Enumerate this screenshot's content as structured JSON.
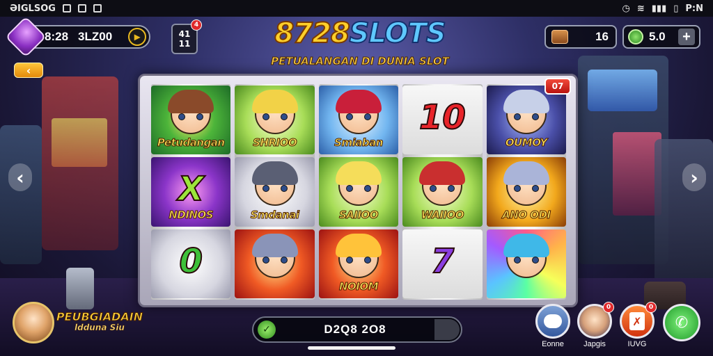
{
  "status_bar": {
    "left_text": "ƏIGLSOG",
    "right_text": "P:N"
  },
  "hud": {
    "time": "8:28",
    "balance": "3LZ00",
    "message_top": "41",
    "message_bottom": "11",
    "message_badge": "4",
    "tickets": "16",
    "score": "5.0"
  },
  "title": {
    "part1": "8728",
    "part2": "SLOTS",
    "subtitle": "PETUALANGAN DI DUNIA SLOT"
  },
  "machine": {
    "corner_badge": "07",
    "reels": [
      [
        {
          "label": "Petudangan",
          "style": "c-green",
          "kind": "face",
          "hair": "#8a4a2a"
        },
        {
          "label": "NDINOS",
          "style": "c-purple",
          "kind": "symbol",
          "symbol": "X",
          "symbol_color": "#9be63a"
        },
        {
          "label": "",
          "style": "c-grey",
          "kind": "symbol",
          "symbol": "0",
          "symbol_color": "#3ec13a"
        }
      ],
      [
        {
          "label": "SHRIOO",
          "style": "c-lime",
          "kind": "face",
          "hair": "#f2d247"
        },
        {
          "label": "Smdanai",
          "style": "c-grey",
          "kind": "face",
          "hair": "#5a5f74"
        },
        {
          "label": "",
          "style": "c-red",
          "kind": "face",
          "hair": "#8a94b8"
        }
      ],
      [
        {
          "label": "Smiaban",
          "style": "c-blue",
          "kind": "face",
          "hair": "#c91f3a"
        },
        {
          "label": "SAIIOO",
          "style": "c-lime",
          "kind": "face",
          "hair": "#f5dd5a"
        },
        {
          "label": "NOIOM",
          "style": "c-red",
          "kind": "face",
          "hair": "#ffc33a"
        }
      ],
      [
        {
          "label": "",
          "style": "c-white",
          "kind": "symbol",
          "symbol": "10",
          "symbol_color": "#e8242a"
        },
        {
          "label": "WAIIOO",
          "style": "c-lime",
          "kind": "face",
          "hair": "#c92f2f"
        },
        {
          "label": "",
          "style": "c-white",
          "kind": "symbol",
          "symbol": "7",
          "symbol_color": "#8a3ee0"
        }
      ],
      [
        {
          "label": "OUMOY",
          "style": "c-night",
          "kind": "face",
          "hair": "#c7d0e8"
        },
        {
          "label": "ANO ODI",
          "style": "c-gold",
          "kind": "face",
          "hair": "#aab4d8"
        },
        {
          "label": "",
          "style": "c-rainbow",
          "kind": "face",
          "hair": "#3fb8e8"
        }
      ]
    ]
  },
  "bottom": {
    "logo_line1": "PEUBGIADAIN",
    "logo_line2": "ldduna Siu",
    "spin_amount": "D2Q8 2O8",
    "buttons": [
      {
        "label": "Eonne",
        "badge": ""
      },
      {
        "label": "Japgis",
        "badge": "0"
      },
      {
        "label": "IUVG",
        "badge": "0"
      },
      {
        "label": "",
        "badge": ""
      }
    ]
  },
  "icons": {
    "back": "chevron-left-icon",
    "prev": "chevron-left-icon",
    "next": "chevron-right-icon",
    "spin": "play-icon",
    "phone": "phone-icon"
  },
  "colors": {
    "title_gold": "#ffcf2a",
    "title_blue": "#5fc8ff",
    "badge_red": "#e0292b",
    "accent_orange": "#e38a0b"
  }
}
